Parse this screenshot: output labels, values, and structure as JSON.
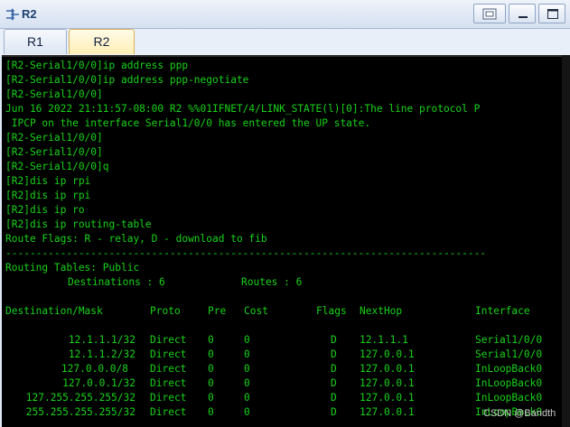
{
  "window": {
    "title": "R2"
  },
  "tabs": [
    {
      "label": "R1"
    },
    {
      "label": "R2"
    }
  ],
  "terminal": {
    "colors": {
      "background": "#000000",
      "text": "#19d219"
    },
    "lines": [
      "[R2-Serial1/0/0]ip address ppp",
      "[R2-Serial1/0/0]ip address ppp-negotiate",
      "[R2-Serial1/0/0]",
      "Jun 16 2022 21:11:57-08:00 R2 %%01IFNET/4/LINK_STATE(l)[0]:The line protocol P",
      " IPCP on the interface Serial1/0/0 has entered the UP state.",
      "[R2-Serial1/0/0]",
      "[R2-Serial1/0/0]",
      "[R2-Serial1/0/0]q",
      "[R2]dis ip rpi",
      "[R2]dis ip rpi",
      "[R2]dis ip ro",
      "[R2]dis ip routing-table",
      "Route Flags: R - relay, D - download to fib",
      "-------------------------------------------------------------------------------",
      "Routing Tables: Public"
    ],
    "summary": {
      "destinations_label": "Destinations : 6",
      "routes_label": "Routes : 6"
    },
    "table": {
      "headers": [
        "Destination/Mask",
        "Proto",
        "Pre",
        "Cost",
        "Flags",
        "NextHop",
        "Interface"
      ],
      "rows": [
        [
          "12.1.1.1/32",
          "Direct",
          "0",
          "0",
          "D",
          "12.1.1.1",
          "Serial1/0/0"
        ],
        [
          "12.1.1.2/32",
          "Direct",
          "0",
          "0",
          "D",
          "127.0.0.1",
          "Serial1/0/0"
        ],
        [
          "127.0.0.0/8",
          "Direct",
          "0",
          "0",
          "D",
          "127.0.0.1",
          "InLoopBack0"
        ],
        [
          "127.0.0.1/32",
          "Direct",
          "0",
          "0",
          "D",
          "127.0.0.1",
          "InLoopBack0"
        ],
        [
          "127.255.255.255/32",
          "Direct",
          "0",
          "0",
          "D",
          "127.0.0.1",
          "InLoopBack0"
        ],
        [
          "255.255.255.255/32",
          "Direct",
          "0",
          "0",
          "D",
          "127.0.0.1",
          "InLoopBack0"
        ]
      ]
    }
  },
  "watermark": "CSDN @Bandth"
}
